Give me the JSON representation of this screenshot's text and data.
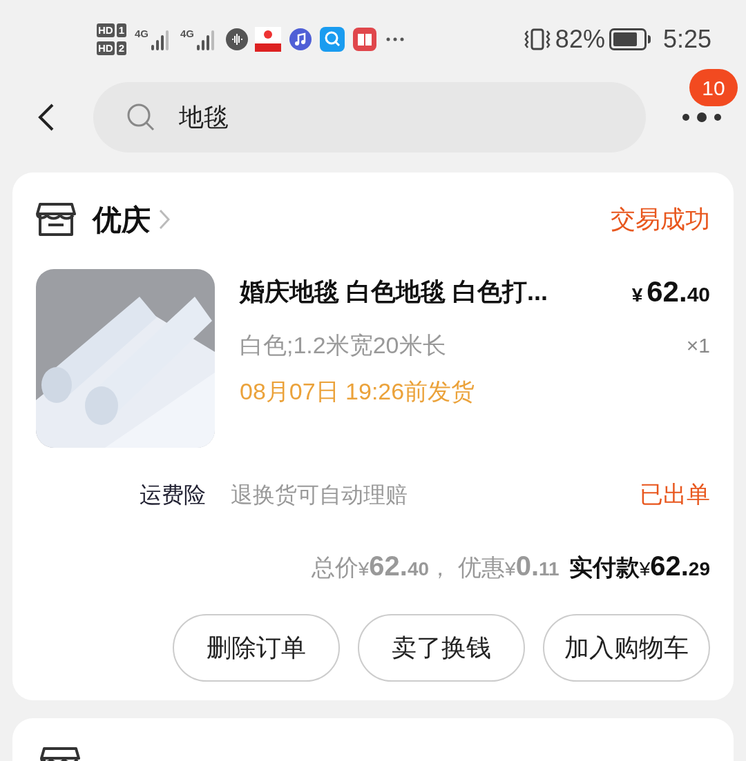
{
  "status_bar": {
    "sims": [
      "HD",
      "1",
      "HD",
      "2"
    ],
    "network": [
      "4G",
      "4G"
    ],
    "battery_text": "82%",
    "time": "5:25"
  },
  "search": {
    "value": "地毯"
  },
  "more": {
    "badge": "10"
  },
  "order": {
    "store": "优庆",
    "status": "交易成功",
    "product": {
      "title": "婚庆地毯 白色地毯 白色打...",
      "price": {
        "currency": "¥",
        "integer": "62.",
        "decimal": "40"
      },
      "spec": "白色;1.2米宽20米长",
      "quantity": "×1",
      "delivery": "08月07日 19:26前发货"
    },
    "insurance": {
      "label": "运费险",
      "desc": "退换货可自动理赔",
      "status": "已出单"
    },
    "totals": [
      {
        "kind": "muted",
        "label": "总价",
        "currency": "¥",
        "integer": "62.",
        "decimal": "40",
        "sep": "，"
      },
      {
        "kind": "muted",
        "label": "优惠",
        "currency": "¥",
        "integer": "0.",
        "decimal": "11"
      },
      {
        "kind": "strong",
        "label": "实付款",
        "currency": "¥",
        "integer": "62.",
        "decimal": "29"
      }
    ],
    "buttons": [
      "删除订单",
      "卖了换钱",
      "加入购物车"
    ]
  }
}
